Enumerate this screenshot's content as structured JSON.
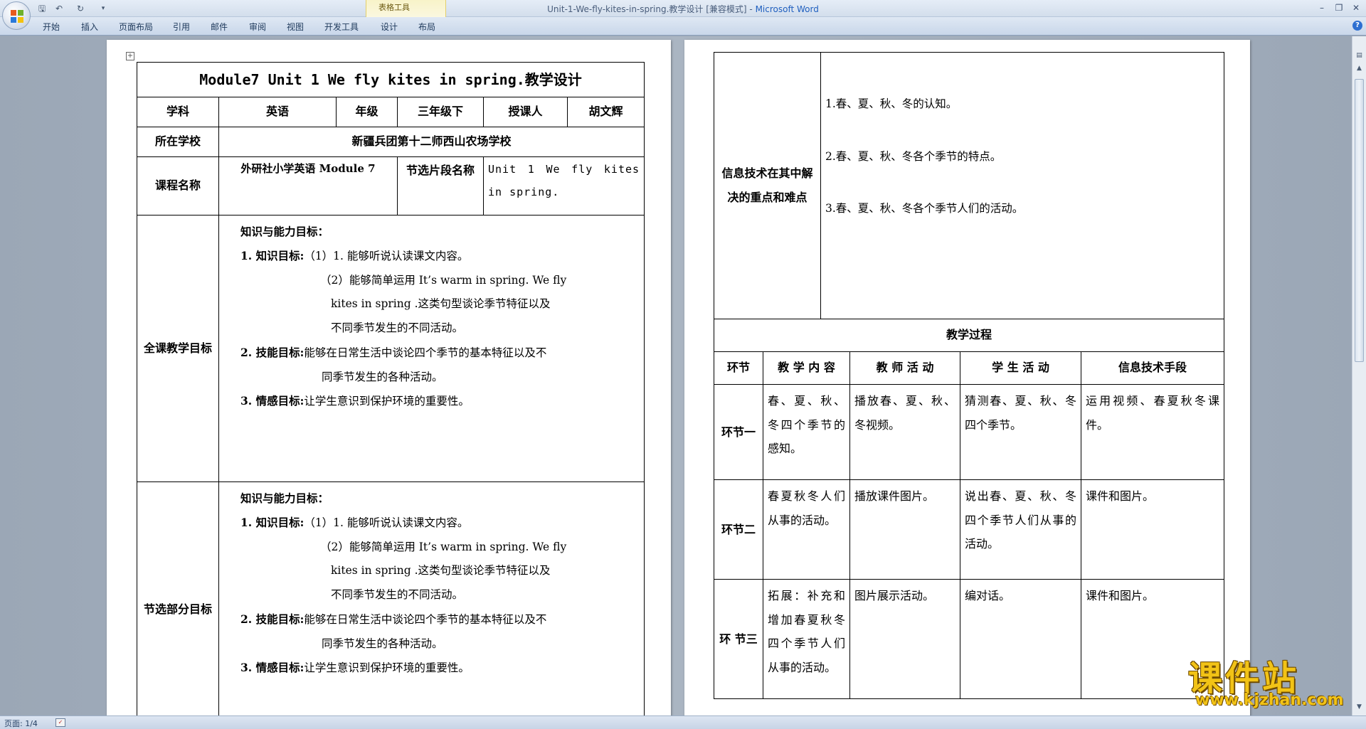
{
  "window": {
    "title": "Unit-1-We-fly-kites-in-spring.教学设计 [兼容模式] - ",
    "app_name": "Microsoft Word",
    "context_tab_group": "表格工具"
  },
  "ribbon": {
    "tabs": [
      "开始",
      "插入",
      "页面布局",
      "引用",
      "邮件",
      "审阅",
      "视图",
      "开发工具",
      "设计",
      "布局"
    ]
  },
  "page1": {
    "title": "Module7 Unit 1 We fly kites in spring.教学设计",
    "row1": {
      "subject_label": "学科",
      "subject": "英语",
      "grade_label": "年级",
      "grade": "三年级下",
      "teacher_label": "授课人",
      "teacher": "胡文辉"
    },
    "school_label": "所在学校",
    "school": "新疆兵团第十二师西山农场学校",
    "course_label": "课程名称",
    "course": "外研社小学英语 Module 7",
    "section_label": "节选片段名称",
    "section": "Unit 1 We fly kites in spring.",
    "goal_all_label": "全课教学目标",
    "goal_sec_label": "节选部分目标",
    "goals": {
      "heading": "知识与能力目标：",
      "k_label": "1. 知识目标:",
      "k1": "（1）1. 能够听说认读课文内容。",
      "k2a": "（2）能够简单运用 It’s warm in spring. We fly",
      "k2b": "kites in spring .这类句型谈论季节特征以及",
      "k2c": "不同季节发生的不同活动。",
      "s_label": "2. 技能目标:",
      "s1": "能够在日常生活中谈论四个季节的基本特征以及不",
      "s2": "同季节发生的各种活动。",
      "e_label": "3. 情感目标:",
      "e1": "让学生意识到保护环境的重要性。"
    }
  },
  "page2": {
    "it_label": "信息技术在其中解决的重点和难点",
    "it_points": [
      "1.春、夏、秋、冬的认知。",
      "2.春、夏、秋、冬各个季节的特点。",
      "3.春、夏、秋、冬各个季节人们的活动。"
    ],
    "process_title": "教学过程",
    "headers": [
      "环节",
      "教 学 内 容",
      "教 师 活 动",
      "学 生 活 动",
      "信息技术手段"
    ],
    "rows": [
      {
        "step": "环节一",
        "content": "春、夏、秋、冬四个季节的感知。",
        "teacher": "播放春、夏、秋、冬视频。",
        "student": "猜测春、夏、秋、冬四个季节。",
        "tech": "运用视频、春夏秋冬课件。"
      },
      {
        "step": "环节二",
        "content": "春夏秋冬人们从事的活动。",
        "teacher": "播放课件图片。",
        "student": "说出春、夏、秋、冬四个季节人们从事的活动。",
        "tech": "课件和图片。"
      },
      {
        "step": "环 节三",
        "content": "拓展：补充和增加春夏秋冬四个季节人们从事的活动。",
        "teacher": "图片展示活动。",
        "student": "编对话。",
        "tech": "课件和图片。"
      }
    ]
  },
  "status": {
    "page_count": "页面: 1/4"
  },
  "watermark": {
    "text": "课件站",
    "url": "www.kjzhan.com"
  },
  "icons": [
    "office-logo-icon",
    "save-icon",
    "undo-icon",
    "redo-icon",
    "customize-icon",
    "minimize-icon",
    "restore-icon",
    "close-icon",
    "help-icon",
    "table-move-handle-icon",
    "scroll-up-icon",
    "scroll-down-icon",
    "ruler-icon",
    "status-spelling-icon"
  ]
}
